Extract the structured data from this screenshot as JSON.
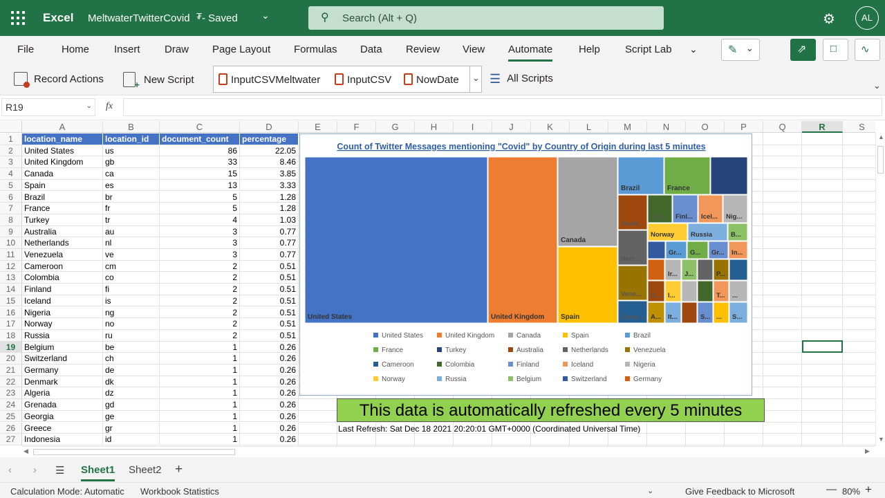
{
  "titlebar": {
    "app": "Excel",
    "document": "MeltwaterTwitterCovid",
    "status": "- Saved",
    "search_placeholder": "Search (Alt + Q)",
    "avatar": "AL"
  },
  "menu": [
    "File",
    "Home",
    "Insert",
    "Draw",
    "Page Layout",
    "Formulas",
    "Data",
    "Review",
    "View",
    "Automate",
    "Help",
    "Script Lab"
  ],
  "ribbon": {
    "record": "Record Actions",
    "new_script": "New Script",
    "scripts": [
      "InputCSVMeltwater",
      "InputCSV",
      "NowDate"
    ],
    "all_scripts": "All Scripts"
  },
  "formula": {
    "name_box": "R19",
    "fx": "fx",
    "value": ""
  },
  "columns": [
    "A",
    "B",
    "C",
    "D",
    "E",
    "F",
    "G",
    "H",
    "I",
    "J",
    "K",
    "L",
    "M",
    "N",
    "O",
    "P",
    "Q",
    "R",
    "S"
  ],
  "headers": [
    "location_name",
    "location_id",
    "document_count",
    "percentage"
  ],
  "rows": [
    [
      "United States",
      "us",
      "86",
      "22.05"
    ],
    [
      "United Kingdom",
      "gb",
      "33",
      "8.46"
    ],
    [
      "Canada",
      "ca",
      "15",
      "3.85"
    ],
    [
      "Spain",
      "es",
      "13",
      "3.33"
    ],
    [
      "Brazil",
      "br",
      "5",
      "1.28"
    ],
    [
      "France",
      "fr",
      "5",
      "1.28"
    ],
    [
      "Turkey",
      "tr",
      "4",
      "1.03"
    ],
    [
      "Australia",
      "au",
      "3",
      "0.77"
    ],
    [
      "Netherlands",
      "nl",
      "3",
      "0.77"
    ],
    [
      "Venezuela",
      "ve",
      "3",
      "0.77"
    ],
    [
      "Cameroon",
      "cm",
      "2",
      "0.51"
    ],
    [
      "Colombia",
      "co",
      "2",
      "0.51"
    ],
    [
      "Finland",
      "fi",
      "2",
      "0.51"
    ],
    [
      "Iceland",
      "is",
      "2",
      "0.51"
    ],
    [
      "Nigeria",
      "ng",
      "2",
      "0.51"
    ],
    [
      "Norway",
      "no",
      "2",
      "0.51"
    ],
    [
      "Russia",
      "ru",
      "2",
      "0.51"
    ],
    [
      "Belgium",
      "be",
      "1",
      "0.26"
    ],
    [
      "Switzerland",
      "ch",
      "1",
      "0.26"
    ],
    [
      "Germany",
      "de",
      "1",
      "0.26"
    ],
    [
      "Denmark",
      "dk",
      "1",
      "0.26"
    ],
    [
      "Algeria",
      "dz",
      "1",
      "0.26"
    ],
    [
      "Grenada",
      "gd",
      "1",
      "0.26"
    ],
    [
      "Georgia",
      "ge",
      "1",
      "0.26"
    ],
    [
      "Greece",
      "gr",
      "1",
      "0.26"
    ],
    [
      "Indonesia",
      "id",
      "1",
      "0.26"
    ]
  ],
  "chart": {
    "title": "Count of Twitter Messages mentioning \"Covid\" by Country of Origin during last 5 minutes",
    "tile_labels": [
      "United States",
      "United Kingdom",
      "Canada",
      "Spain",
      "Brazil",
      "France",
      "Austr...",
      "Col...",
      "Finl...",
      "Icel...",
      "Nig...",
      "Neth...",
      "Norway",
      "Russia",
      "B...",
      "Gr...",
      "G...",
      "Gr...",
      "In...",
      "Vene...",
      "Ir...",
      "J...",
      "P...",
      "G...",
      "D...",
      "I...",
      "T...",
      "...",
      "Came...",
      "A...",
      "It...",
      "S...",
      "...",
      "S..."
    ],
    "legend": [
      {
        "name": "United States",
        "color": "#4472c4"
      },
      {
        "name": "United Kingdom",
        "color": "#ed7d31"
      },
      {
        "name": "Canada",
        "color": "#a5a5a5"
      },
      {
        "name": "Spain",
        "color": "#ffc000"
      },
      {
        "name": "Brazil",
        "color": "#5b9bd5"
      },
      {
        "name": "France",
        "color": "#70ad47"
      },
      {
        "name": "Turkey",
        "color": "#264478"
      },
      {
        "name": "Australia",
        "color": "#9e480e"
      },
      {
        "name": "Netherlands",
        "color": "#636363"
      },
      {
        "name": "Venezuela",
        "color": "#997300"
      },
      {
        "name": "Cameroon",
        "color": "#255e91"
      },
      {
        "name": "Colombia",
        "color": "#43682b"
      },
      {
        "name": "Finland",
        "color": "#698ed0"
      },
      {
        "name": "Iceland",
        "color": "#f1975a"
      },
      {
        "name": "Nigeria",
        "color": "#b7b7b7"
      },
      {
        "name": "Norway",
        "color": "#ffcd33"
      },
      {
        "name": "Russia",
        "color": "#7cafdd"
      },
      {
        "name": "Belgium",
        "color": "#8cc168"
      },
      {
        "name": "Switzerland",
        "color": "#335aa1"
      },
      {
        "name": "Germany",
        "color": "#d26012"
      }
    ]
  },
  "banner": "This data is automatically refreshed every 5 minutes",
  "last_refresh": "Last Refresh: Sat Dec 18 2021 20:20:01 GMT+0000 (Coordinated Universal Time)",
  "sheets": [
    "Sheet1",
    "Sheet2"
  ],
  "status": {
    "calc": "Calculation Mode: Automatic",
    "stats": "Workbook Statistics",
    "feedback": "Give Feedback to Microsoft",
    "zoom": "80%"
  }
}
